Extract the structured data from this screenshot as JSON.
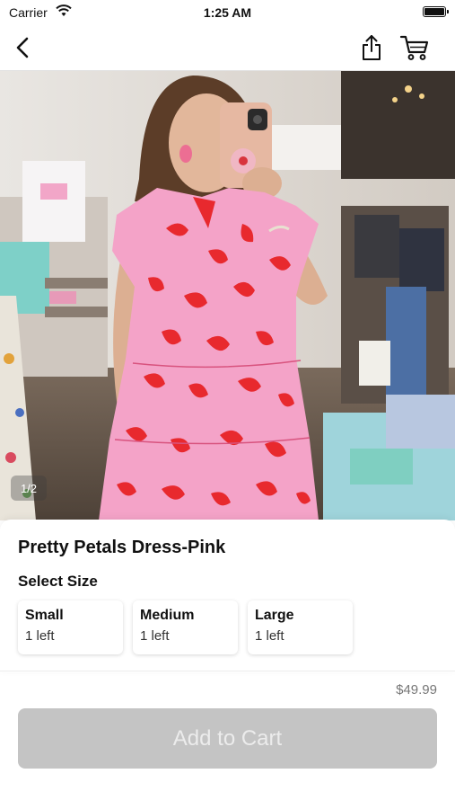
{
  "status_bar": {
    "carrier": "Carrier",
    "time": "1:25 AM"
  },
  "nav": {
    "back_icon": "chevron-left-icon",
    "share_icon": "share-icon",
    "cart_icon": "cart-icon"
  },
  "gallery": {
    "indicator": "1/2"
  },
  "product": {
    "title": "Pretty Petals Dress-Pink",
    "select_size_label": "Select Size",
    "sizes": [
      {
        "name": "Small",
        "stock": "1 left"
      },
      {
        "name": "Medium",
        "stock": "1 left"
      },
      {
        "name": "Large",
        "stock": "1 left"
      }
    ],
    "price": "$49.99",
    "add_to_cart_label": "Add to Cart"
  },
  "colors": {
    "button_disabled": "#c4c4c4",
    "dress_pink": "#f4a3c8",
    "dress_red": "#e8292e"
  }
}
